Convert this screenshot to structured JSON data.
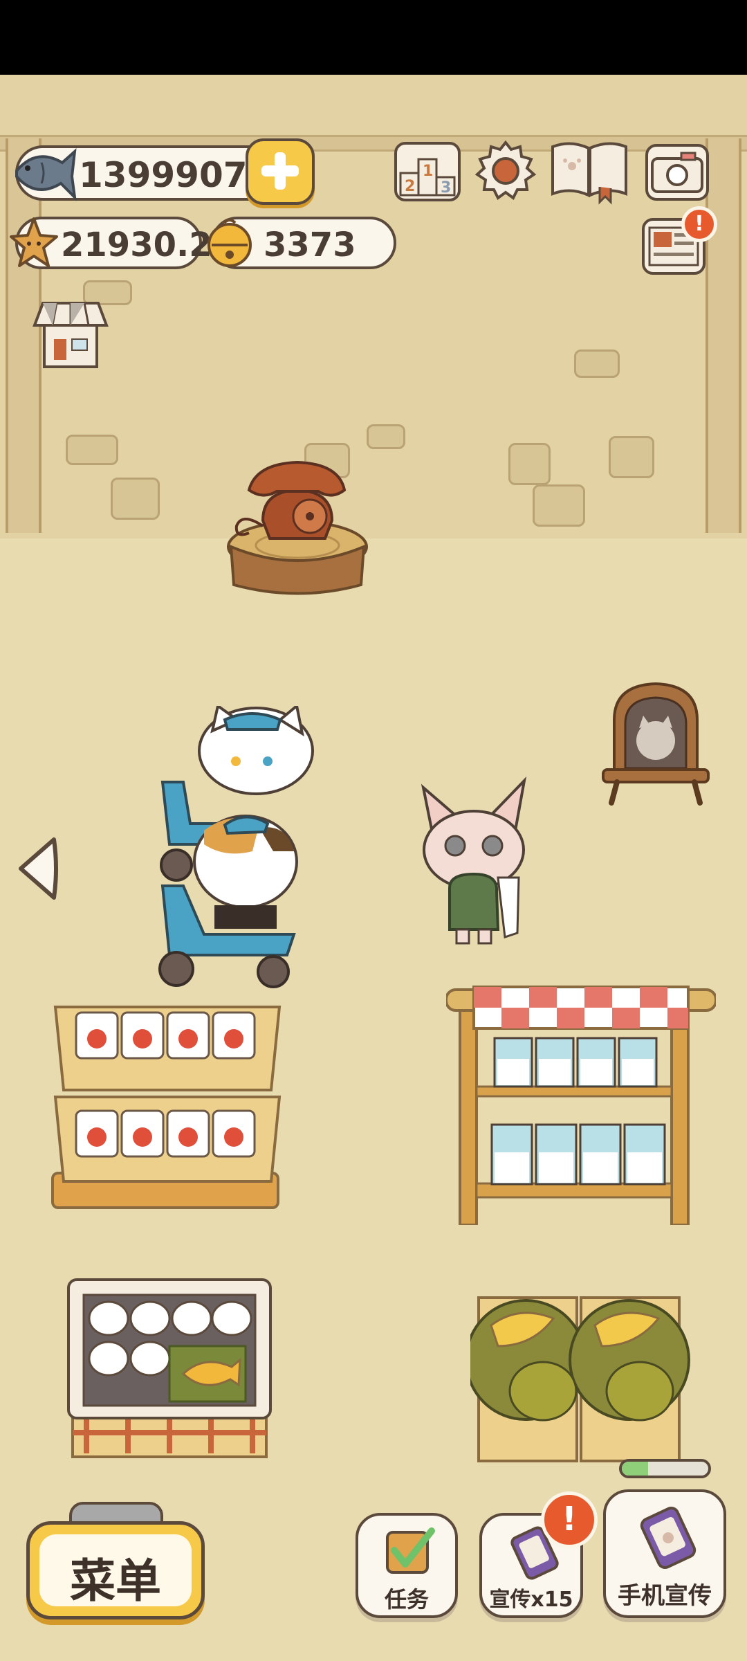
{
  "currencies": {
    "fish": {
      "icon": "fish-icon",
      "value": "1399907"
    },
    "stars": {
      "icon": "star-icon",
      "value": "21930.2"
    },
    "bells": {
      "icon": "bell-icon",
      "value": "3373"
    }
  },
  "top_icons": {
    "add": "plus-icon",
    "ranking": "ranking-podium-icon",
    "ranking_digits": [
      "2",
      "1",
      "3"
    ],
    "settings": "gear-icon",
    "guide": "open-book-icon",
    "camera": "camera-icon",
    "news": "newspaper-icon",
    "shop": "shop-icon"
  },
  "badges": {
    "news": "!",
    "promo": "!"
  },
  "scene": {
    "telephone": "rotary-telephone",
    "sign": "cat-signboard",
    "left_arrow": "chevron-left-icon"
  },
  "promo_progress": 0.3,
  "bottom_bar": {
    "menu_label": "菜单",
    "tasks_label": "任务",
    "promo_label": "宣传x15",
    "phone_promo_label": "手机宣传"
  },
  "colors": {
    "accent_yellow": "#f7c948",
    "alert_orange": "#e65a2e",
    "outline_brown": "#5b4a3b",
    "scooter_blue": "#4aa3c5"
  }
}
